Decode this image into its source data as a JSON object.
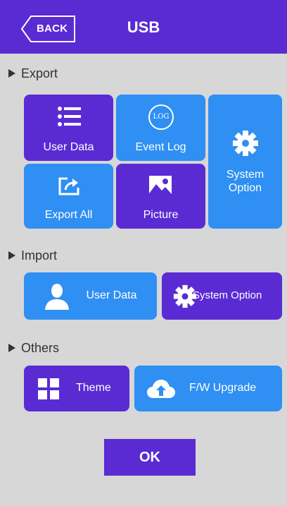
{
  "header": {
    "back_label": "BACK",
    "title": "USB"
  },
  "sections": {
    "export": "Export",
    "import": "Import",
    "others": "Others"
  },
  "export": {
    "user_data": "User Data",
    "event_log": "Event Log",
    "event_log_icon_text": "LOG",
    "system_option": "System Option",
    "export_all": "Export All",
    "picture": "Picture"
  },
  "import": {
    "user_data": "User Data",
    "system_option": "System Option"
  },
  "others": {
    "theme": "Theme",
    "fw_upgrade": "F/W Upgrade"
  },
  "ok_label": "OK",
  "colors": {
    "header": "#5a2bd3",
    "purple": "#5a2bd3",
    "blue": "#2f8ff2",
    "background": "#d7d7d7"
  },
  "icons": [
    "list-icon",
    "log-icon",
    "gear-icon",
    "export-icon",
    "picture-icon",
    "user-icon",
    "theme-icon",
    "cloud-upload-icon"
  ]
}
